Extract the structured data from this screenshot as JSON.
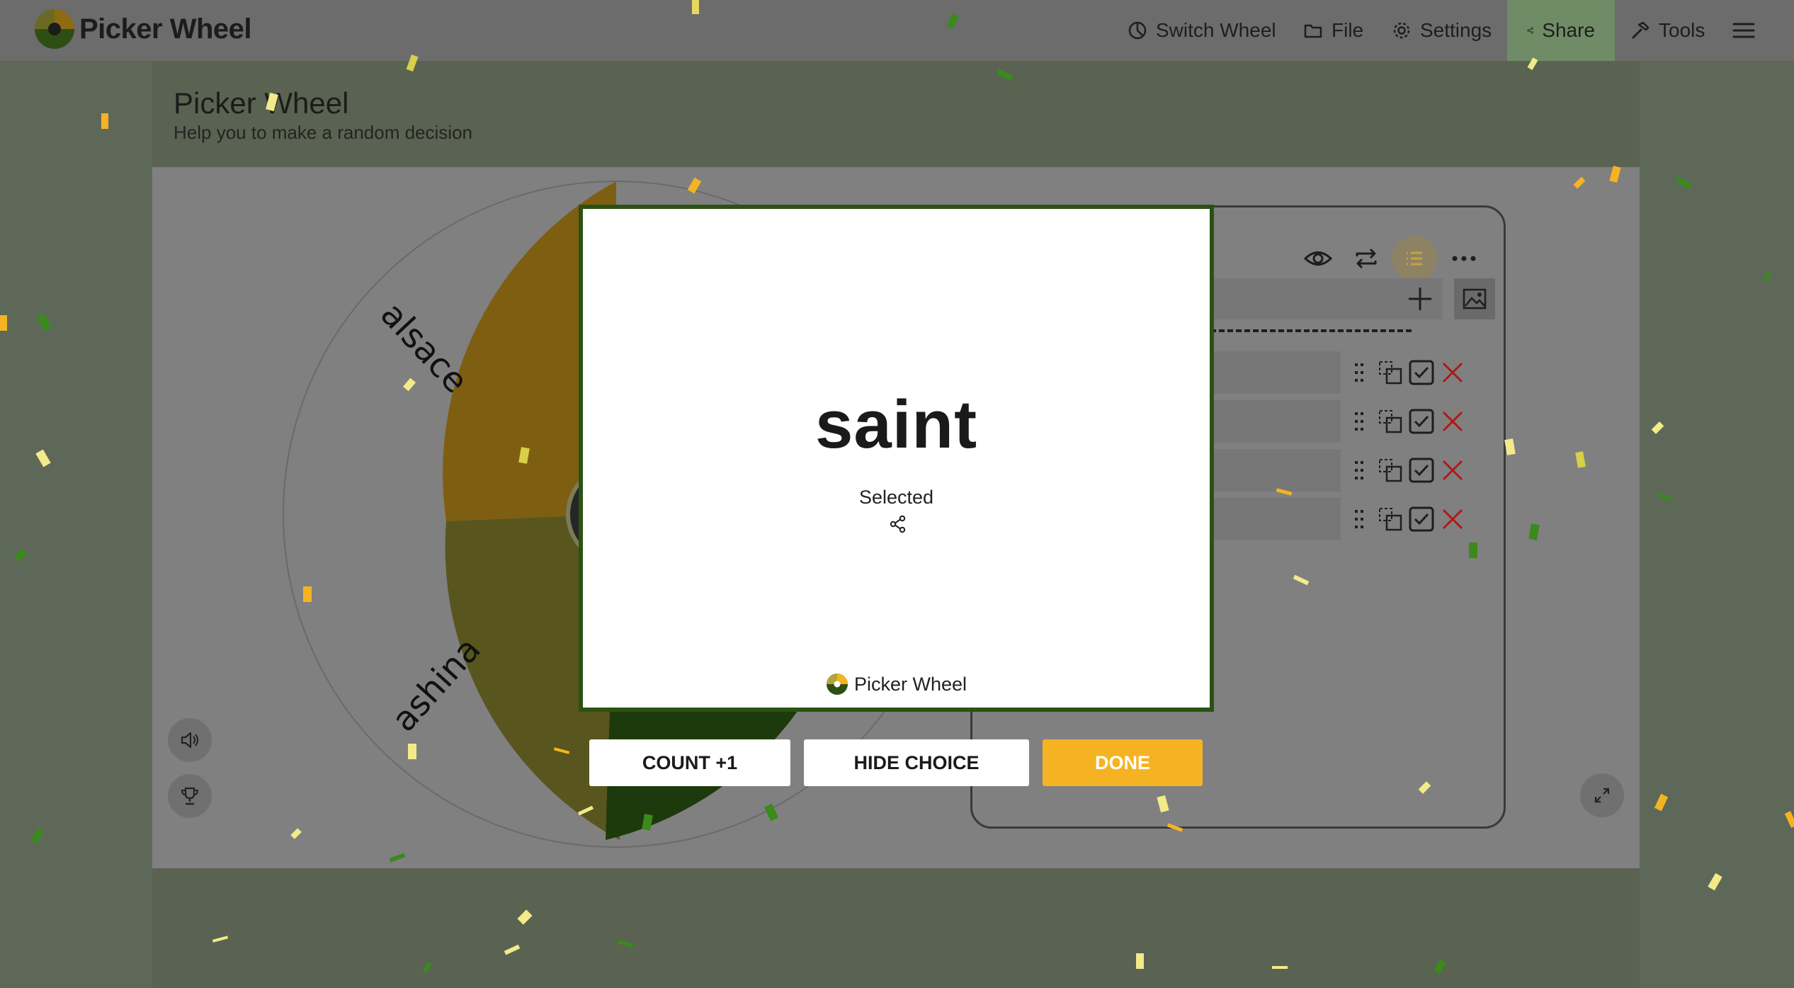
{
  "brand": {
    "name": "Picker Wheel"
  },
  "nav": {
    "switch_wheel": "Switch Wheel",
    "file": "File",
    "settings": "Settings",
    "share": "Share",
    "tools": "Tools"
  },
  "hero": {
    "title": "Picker Wheel",
    "subtitle": "Help you to make a random decision"
  },
  "wheel": {
    "slices": [
      {
        "label": "alsace",
        "color": "#7e5e10"
      },
      {
        "label": "ashina",
        "color": "#58561e"
      },
      {
        "label": "saint",
        "color": "#1d3a0c"
      }
    ]
  },
  "entries_panel": {
    "entry_count": 4,
    "icons": [
      "eye-icon",
      "repeat-icon",
      "list-icon",
      "more-icon",
      "plus-icon",
      "image-icon",
      "drag-icon",
      "duplicate-icon",
      "checkbox-icon",
      "delete-icon"
    ]
  },
  "result_modal": {
    "result": "saint",
    "status": "Selected",
    "footer_brand": "Picker Wheel"
  },
  "actions": {
    "count": "COUNT +1",
    "hide": "HIDE CHOICE",
    "done": "DONE"
  },
  "colors": {
    "accent_yellow": "#f5b323",
    "modal_border": "#2b5214",
    "delete_red": "#b01818",
    "share_active": "#6f8c66"
  }
}
